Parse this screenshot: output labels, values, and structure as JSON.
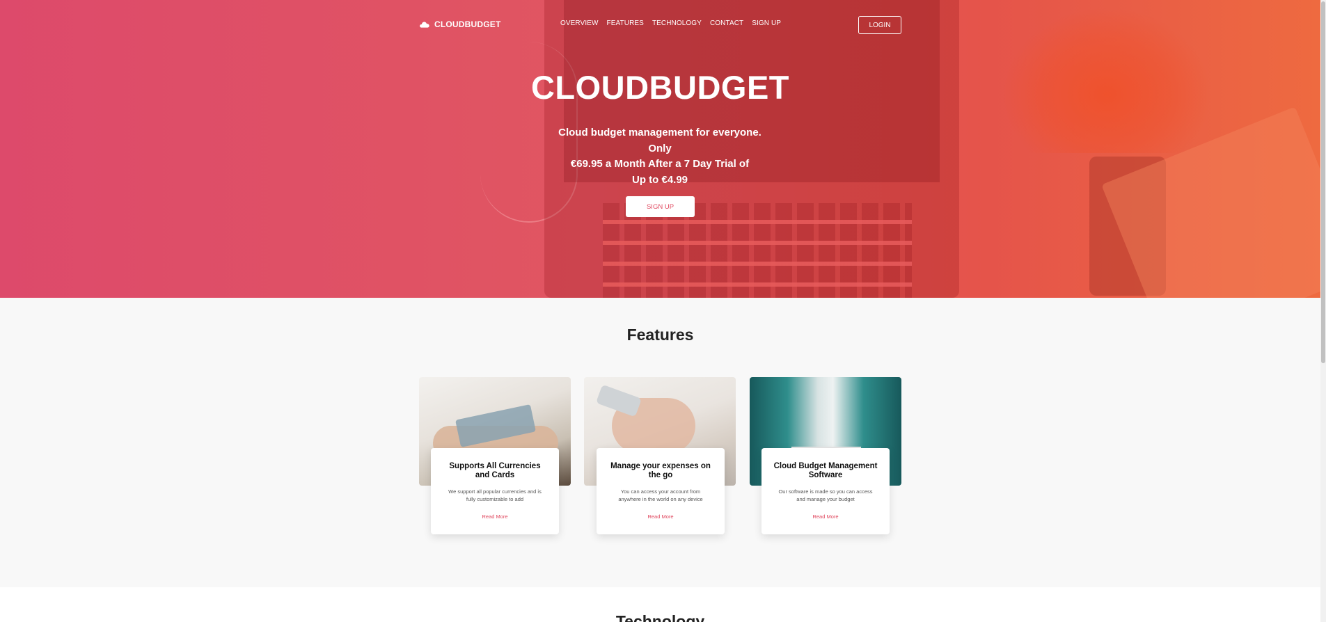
{
  "nav": {
    "logo_text": "CLOUDBUDGET",
    "logo_icon": "cloud-icon",
    "links": [
      "OVERVIEW",
      "FEATURES",
      "TECHNOLOGY",
      "CONTACT",
      "SIGN UP"
    ],
    "login_label": "LOGIN"
  },
  "hero": {
    "title": "CLOUDBUDGET",
    "subtitle_lines": [
      "Cloud budget management for everyone. Only",
      "€69.95 a Month After a 7 Day Trial of",
      "Up to €4.99"
    ],
    "signup_label": "SIGN UP"
  },
  "features": {
    "title": "Features",
    "cards": [
      {
        "title": "Supports All Currencies and Cards",
        "text": "We support all popular currencies and is fully customizable to add",
        "link": "Read More"
      },
      {
        "title": "Manage your expenses on the go",
        "text": "You can access your account from anywhere in the world on any device",
        "link": "Read More"
      },
      {
        "title": "Cloud Budget Management Software",
        "text": "Our software is made so you can access and manage your budget",
        "link": "Read More"
      }
    ]
  },
  "technology": {
    "title": "Technology"
  },
  "colors": {
    "accent": "#e0485f",
    "hero_start": "#dd4a6b",
    "hero_end": "#ee6a40"
  }
}
